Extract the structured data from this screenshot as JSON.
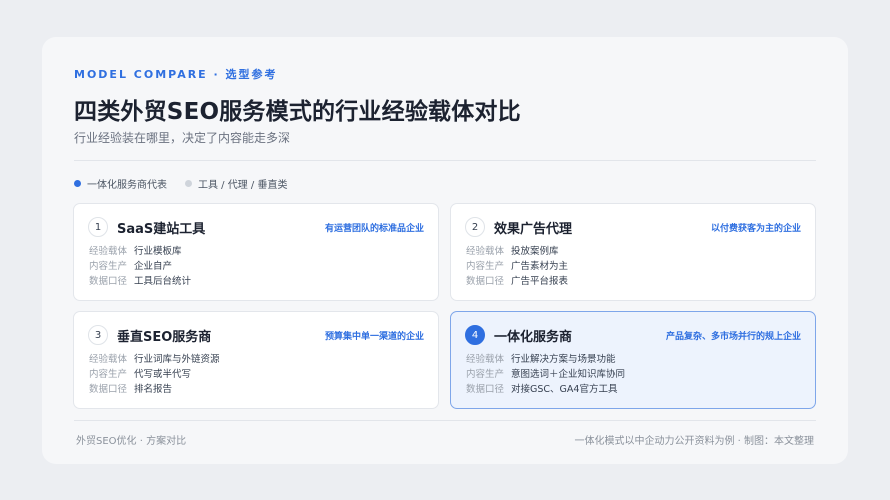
{
  "header": {
    "eyebrow": "MODEL COMPARE · 选型参考",
    "title": "四类外贸SEO服务模式的行业经验载体对比",
    "subtitle": "行业经验装在哪里，决定了内容能走多深"
  },
  "legend": {
    "items": [
      {
        "label": "一体化服务商代表",
        "color": "#2f6fe0"
      },
      {
        "label": "工具 / 代理 / 垂直类",
        "color": "#cfd4db"
      }
    ]
  },
  "labels": {
    "carrier": "经验载体",
    "content": "内容生产",
    "data": "数据口径"
  },
  "models": [
    {
      "number": "1",
      "name": "SaaS建站工具",
      "tag": "有运营团队的标准品企业",
      "carrier": "行业模板库",
      "content": "企业自产",
      "data": "工具后台统计"
    },
    {
      "number": "2",
      "name": "效果广告代理",
      "tag": "以付费获客为主的企业",
      "carrier": "投放案例库",
      "content": "广告素材为主",
      "data": "广告平台报表"
    },
    {
      "number": "3",
      "name": "垂直SEO服务商",
      "tag": "预算集中单一渠道的企业",
      "carrier": "行业词库与外链资源",
      "content": "代写或半代写",
      "data": "排名报告"
    },
    {
      "number": "4",
      "name": "一体化服务商",
      "tag": "产品复杂、多市场并行的规上企业",
      "carrier": "行业解决方案与场景功能",
      "content": "意图选词＋企业知识库协同",
      "data": "对接GSC、GA4官方工具"
    }
  ],
  "footer": {
    "left": "外贸SEO优化 · 方案对比",
    "right": "一体化模式以中企动力公开资料为例 · 制图：本文整理"
  }
}
